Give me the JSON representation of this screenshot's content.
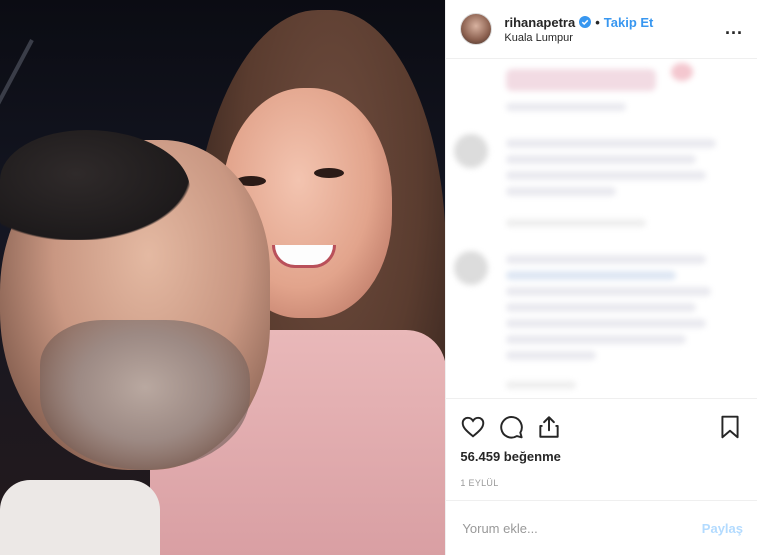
{
  "post": {
    "username": "rihanapetra",
    "separator": "•",
    "follow_label": "Takip Et",
    "location": "Kuala Lumpur",
    "more_label": "...",
    "likes_text": "56.459 beğenme",
    "date": "1 EYLÜL",
    "comment_placeholder": "Yorum ekle...",
    "share_label": "Paylaş"
  },
  "icons": {
    "verified": "verified-badge-icon",
    "like": "heart-icon",
    "comment": "comment-bubble-icon",
    "share": "share-icon",
    "save": "bookmark-icon",
    "more": "more-options-icon"
  },
  "colors": {
    "link": "#3897f0",
    "post_button_disabled": "#b3dbff",
    "text": "#262626",
    "muted": "#999999"
  }
}
